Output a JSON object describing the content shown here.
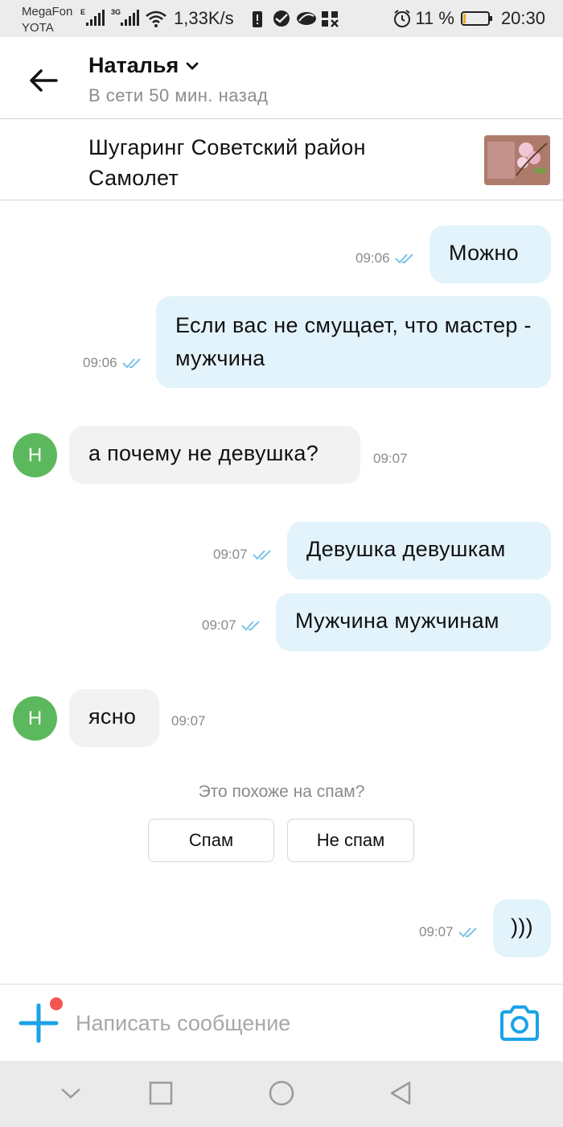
{
  "status_bar": {
    "carrier1": "MegaFon",
    "carrier2": "YOTA",
    "net1": "E",
    "net2": "3G",
    "speed": "1,33K/s",
    "battery_pct": "11 %",
    "time": "20:30",
    "battery_level": 0.11,
    "battery_color": "#f5a623"
  },
  "header": {
    "contact_name": "Наталья",
    "contact_status": "В сети 50 мин. назад"
  },
  "listing": {
    "title": "Шугаринг Советский район Самолет"
  },
  "messages": [
    {
      "dir": "out",
      "text": "Можно",
      "time": "09:06"
    },
    {
      "dir": "out",
      "text": "Если вас не смущает, что мастер - мужчина",
      "time": "09:06"
    },
    {
      "dir": "in",
      "avatar": "Н",
      "text": "а почему не девушка?",
      "time": "09:07"
    },
    {
      "dir": "out",
      "text": "Девушка девушкам",
      "time": "09:07"
    },
    {
      "dir": "out",
      "text": "Мужчина мужчинам",
      "time": "09:07"
    },
    {
      "dir": "in",
      "avatar": "Н",
      "text": "ясно",
      "time": "09:07"
    },
    {
      "dir": "out",
      "text": ")))",
      "time": "09:07"
    }
  ],
  "spam": {
    "question": "Это похоже на спам?",
    "spam_label": "Спам",
    "not_spam_label": "Не спам"
  },
  "input": {
    "placeholder": "Написать сообщение"
  },
  "colors": {
    "accent": "#1aa3e8",
    "outgoing_bubble": "#e3f3fc",
    "incoming_bubble": "#f2f2f2",
    "avatar": "#5cb85c",
    "read_check": "#7cc3e8",
    "notification_dot": "#f4574f"
  }
}
